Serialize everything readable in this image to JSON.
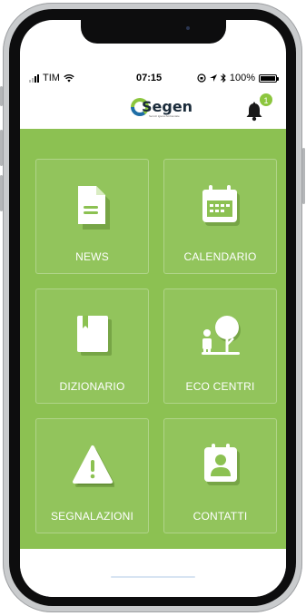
{
  "status_bar": {
    "carrier": "TIM",
    "time": "07:15",
    "battery": "100%",
    "icons": [
      "signal-icon",
      "wifi-icon",
      "orientation-lock-icon",
      "location-icon",
      "bluetooth-icon",
      "battery-icon"
    ]
  },
  "header": {
    "logo_text": "Segen",
    "logo_subtext": "Servizi Igiene Ambientale",
    "notifications_count": "1",
    "bell_icon": "bell-icon"
  },
  "colors": {
    "accent": "#8cc152",
    "badge": "#8cc63e",
    "tile_text": "#ffffff"
  },
  "tiles": [
    {
      "label": "NEWS",
      "icon": "document-icon"
    },
    {
      "label": "CALENDARIO",
      "icon": "calendar-icon"
    },
    {
      "label": "DIZIONARIO",
      "icon": "book-icon"
    },
    {
      "label": "ECO CENTRI",
      "icon": "eco-center-icon"
    },
    {
      "label": "SEGNALAZIONI",
      "icon": "warning-icon"
    },
    {
      "label": "CONTATTI",
      "icon": "contact-icon"
    }
  ]
}
